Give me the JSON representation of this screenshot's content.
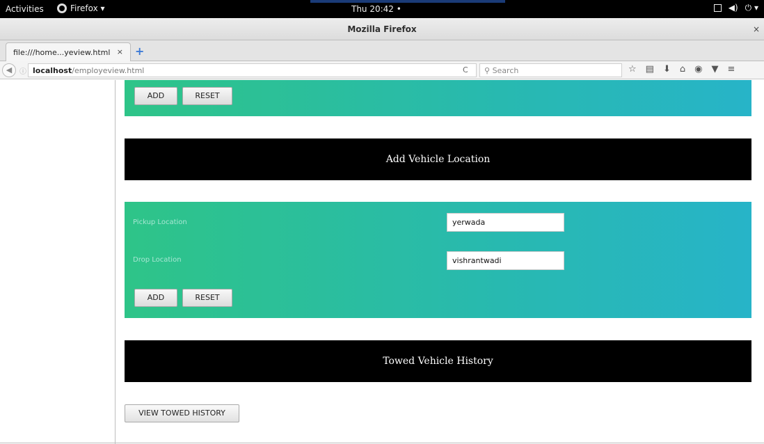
{
  "system_bar": {
    "activities": "Activities",
    "app_menu": "Firefox ▾",
    "clock": "Thu 20:42 •",
    "tray_icons": [
      "window-icon",
      "volume-icon",
      "power-icon"
    ]
  },
  "window": {
    "title": "Mozilla Firefox",
    "close": "×"
  },
  "tabs": [
    {
      "label": "file:///home...yeview.html",
      "close": "×"
    }
  ],
  "new_tab": "+",
  "navbar": {
    "url_host": "localhost",
    "url_path": "/employeview.html",
    "reload": "C",
    "search_placeholder": "Search",
    "toolbar_icons": [
      "star-icon",
      "reading-list-icon",
      "download-icon",
      "home-icon",
      "pocket-icon",
      "shield-icon",
      "menu-icon"
    ]
  },
  "page": {
    "top_form": {
      "add_label": "ADD",
      "reset_label": "RESET"
    },
    "location_section": {
      "header": "Add Vehicle Location",
      "pickup_label": "Pickup Location",
      "pickup_value": "yerwada",
      "drop_label": "Drop Location",
      "drop_value": "vishrantwadi",
      "add_label": "ADD",
      "reset_label": "RESET"
    },
    "history_section": {
      "header": "Towed Vehicle History",
      "view_button": "VIEW TOWED HISTORY"
    }
  },
  "colors": {
    "panel_gradient_start": "#2ec488",
    "panel_gradient_end": "#27b4c8",
    "header_bg": "#000000"
  }
}
